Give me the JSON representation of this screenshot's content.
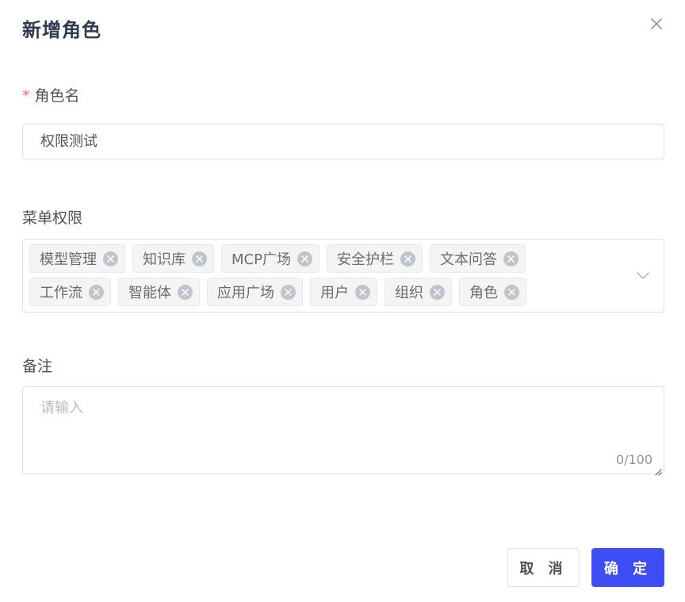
{
  "dialog": {
    "title": "新增角色",
    "close_icon": "close-icon"
  },
  "form": {
    "role_name": {
      "required_mark": "*",
      "label": "角色名",
      "value": "权限测试"
    },
    "menu_permissions": {
      "label": "菜单权限",
      "rows": [
        [
          "模型管理",
          "知识库",
          "MCP广场",
          "安全护栏",
          "文本问答"
        ],
        [
          "工作流",
          "智能体",
          "应用广场",
          "用户",
          "组织",
          "角色"
        ]
      ],
      "dropdown_icon": "chevron-down-icon"
    },
    "remark": {
      "label": "备注",
      "placeholder": "请输入",
      "counter": "0/100"
    }
  },
  "footer": {
    "cancel_label": "取 消",
    "confirm_label": "确 定"
  },
  "colors": {
    "primary": "#3e4ef5",
    "required": "#f56c6c",
    "tag_bg": "#f4f4f5",
    "border": "#dcdfe6"
  }
}
